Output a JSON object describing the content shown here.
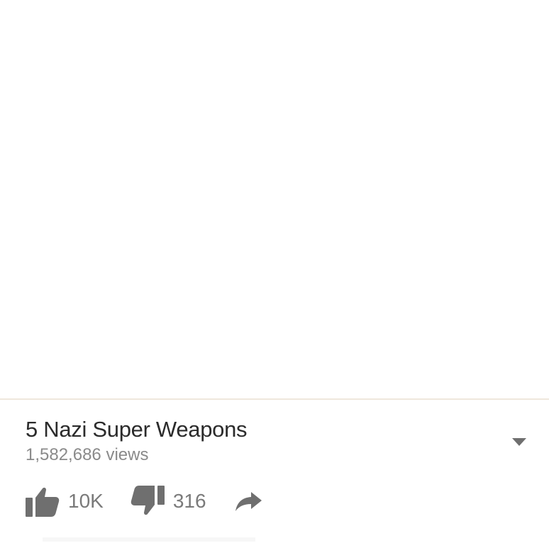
{
  "video": {
    "title": "5 Nazi Super Weapons",
    "views": "1,582,686 views"
  },
  "actions": {
    "like_count": "10K",
    "dislike_count": "316"
  },
  "icons": {
    "like": "thumbs-up-icon",
    "dislike": "thumbs-down-icon",
    "share": "share-arrow-icon",
    "expand": "caret-down-icon"
  },
  "colors": {
    "icon": "#6f6f6f",
    "title": "#2b2b2b",
    "secondary_text": "#8a8a8a"
  }
}
